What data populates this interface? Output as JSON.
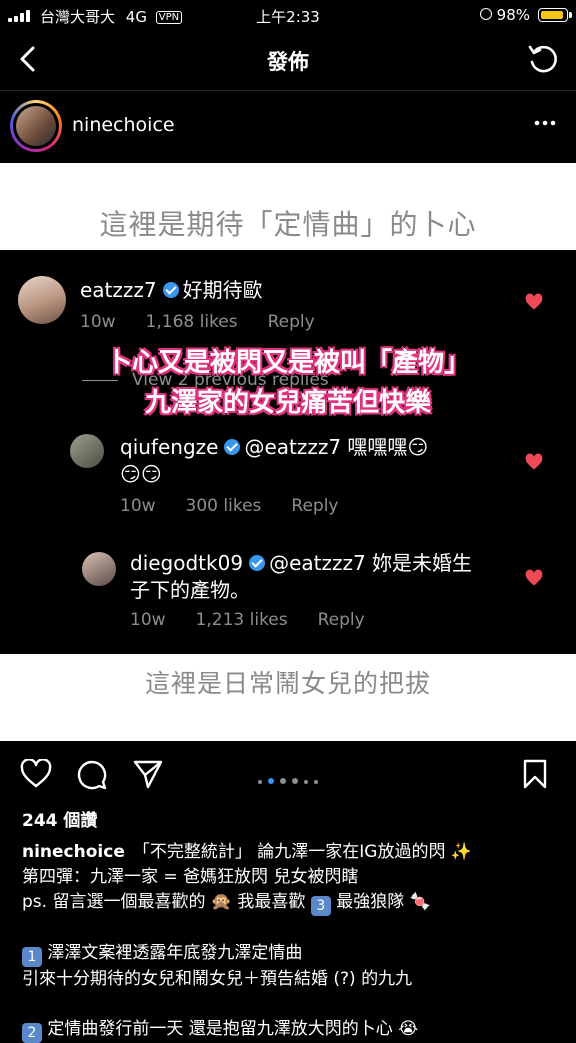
{
  "status": {
    "carrier": "台灣大哥大",
    "network": "4G",
    "vpn": "VPN",
    "time": "上午2:33",
    "battery": "98%",
    "battery_level": 0.98
  },
  "nav": {
    "title": "發佈"
  },
  "profile": {
    "username": "ninechoice"
  },
  "post": {
    "caption_top": "這裡是期待「定情曲」的卜心",
    "caption_bottom": "這裡是日常鬧女兒的把拔",
    "overlay_line1": "卜心又是被閃又是被叫「產物」",
    "overlay_line2": "九澤家的女兒痛苦但快樂",
    "view_previous": "View 2 previous replies",
    "comments": [
      {
        "user": "eatzzz7",
        "text": "好期待歐",
        "time": "10w",
        "likes": "1,168 likes",
        "reply": "Reply"
      },
      {
        "user": "qiufengze",
        "text": "@eatzzz7 嘿嘿嘿😏",
        "text2": "😏😏",
        "time": "10w",
        "likes": "300 likes",
        "reply": "Reply"
      },
      {
        "user": "diegodtk09",
        "text": "@eatzzz7 妳是未婚生",
        "text2": "子下的產物。",
        "time": "10w",
        "likes": "1,213 likes",
        "reply": "Reply"
      }
    ]
  },
  "actions": {
    "like_icon": "heart-icon",
    "comment_icon": "comment-icon",
    "share_icon": "send-icon",
    "save_icon": "bookmark-icon"
  },
  "views": "244 個讚",
  "caption": {
    "user": "ninechoice",
    "line1": "「不完整統計」 論九澤一家在IG放過的閃 ✨",
    "line2": "第四彈：九澤一家 = 爸媽狂放閃 兒女被閃瞎",
    "line3a": "ps. 留言選一個最喜歡的 🙊 我最喜歡",
    "line3_num": "3",
    "line3b": "最強狼隊 🍬",
    "line4_num": "1",
    "line4": "澤澤文案裡透露年底發九澤定情曲",
    "line5": "引來十分期待的女兒和鬧女兒＋預告結婚 (?) 的九九",
    "line6_num": "2",
    "line6": "定情曲發行前一天 還是抱留九澤放大閃的卜心 😭"
  }
}
